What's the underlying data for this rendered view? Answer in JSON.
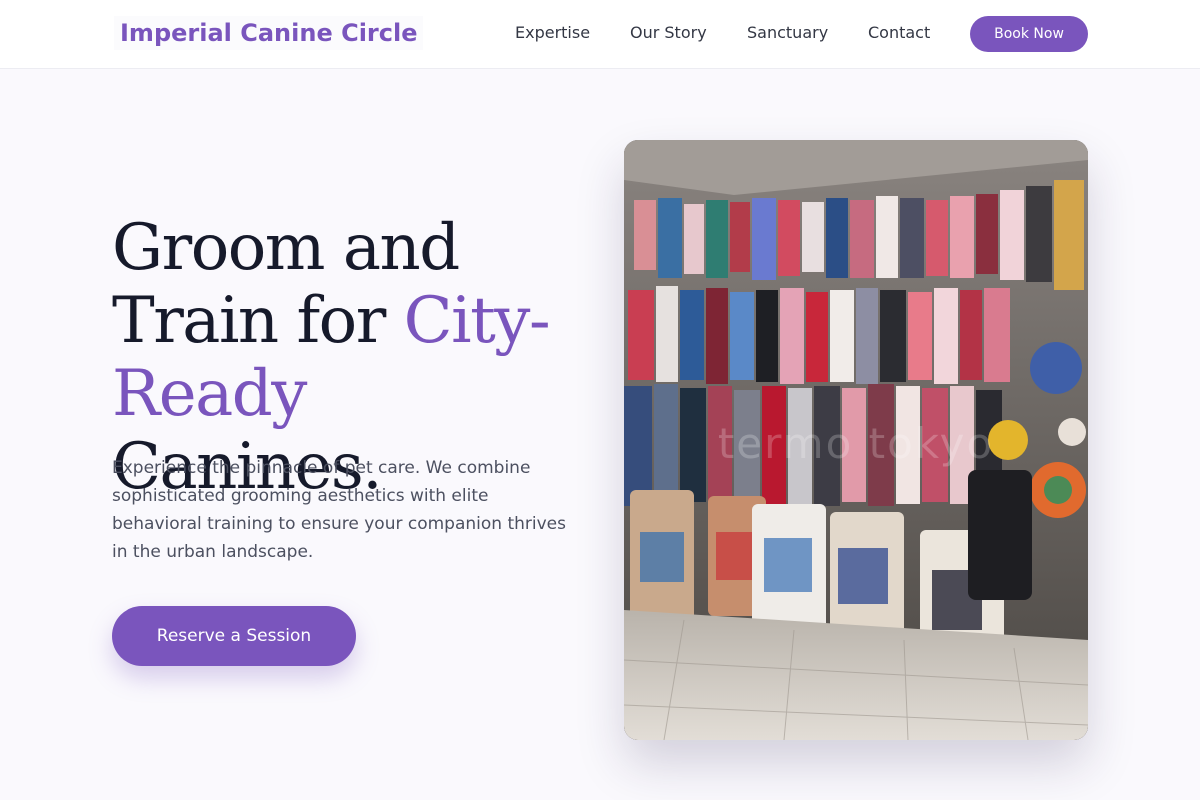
{
  "header": {
    "brand": "Imperial Canine Circle",
    "nav": [
      {
        "label": "Expertise"
      },
      {
        "label": "Our Story"
      },
      {
        "label": "Sanctuary"
      },
      {
        "label": "Contact"
      }
    ],
    "book_label": "Book Now"
  },
  "hero": {
    "headline_part1": "Groom and Train for ",
    "headline_accent": "City-Ready",
    "headline_part2": " Canines.",
    "lead": "Experience the pinnacle of pet care. We combine sophisticated grooming aesthetics with elite behavioral training to ensure your companion thrives in the urban landscape.",
    "cta_label": "Reserve a Session",
    "watermark": "termo tokyo"
  },
  "colors": {
    "accent": "#7a55bd",
    "heading": "#161a2b",
    "body_text": "#4c5060",
    "background": "#faf9fd"
  }
}
